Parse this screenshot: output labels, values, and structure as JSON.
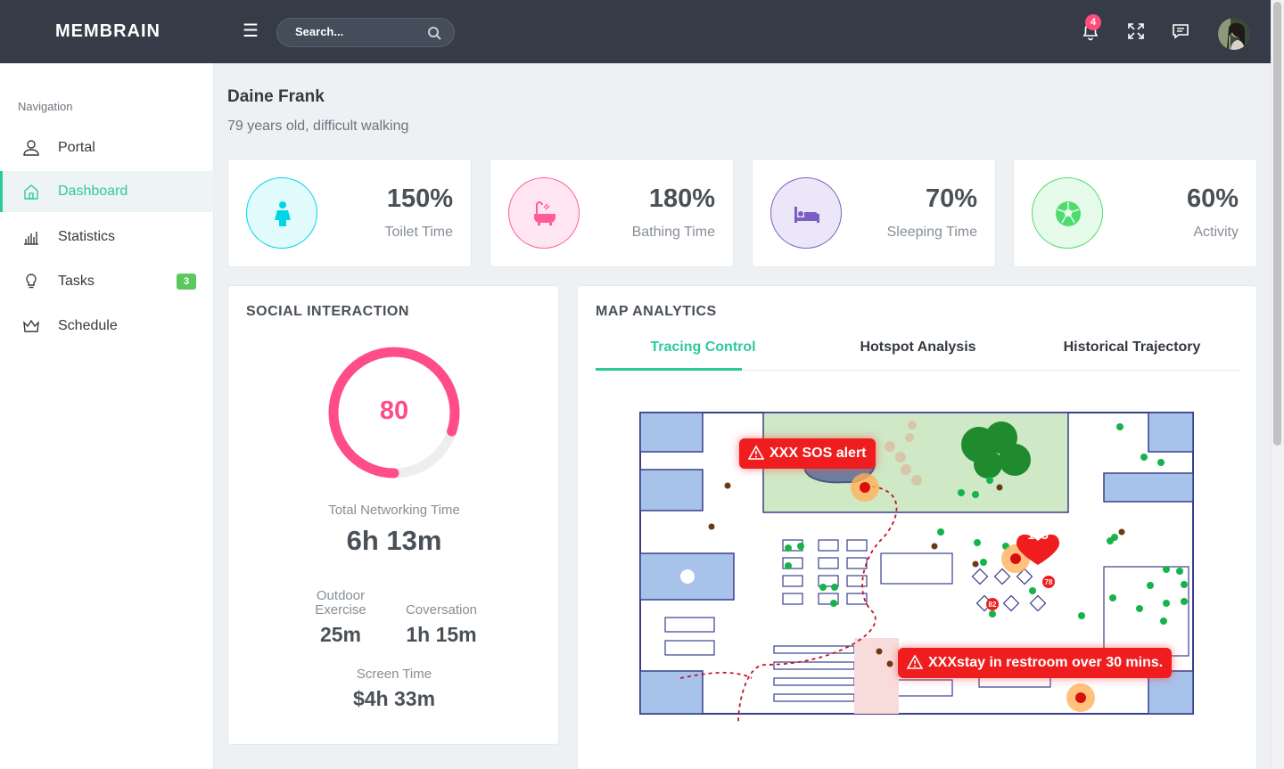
{
  "app": {
    "brand": "MEMBRAIN"
  },
  "search": {
    "placeholder": "Search..."
  },
  "topbar": {
    "notification_count": "4"
  },
  "sidebar": {
    "heading": "Navigation",
    "items": [
      {
        "label": "Portal",
        "icon": "user-icon",
        "active": false
      },
      {
        "label": "Dashboard",
        "icon": "home-icon",
        "active": true
      },
      {
        "label": "Statistics",
        "icon": "bar-chart-icon",
        "active": false
      },
      {
        "label": "Tasks",
        "icon": "lightbulb-icon",
        "active": false,
        "badge": "3"
      },
      {
        "label": "Schedule",
        "icon": "crown-icon",
        "active": false
      }
    ]
  },
  "patient": {
    "name": "Daine Frank",
    "description": "79 years old, difficult walking"
  },
  "stats": [
    {
      "value": "150%",
      "label": "Toilet Time",
      "icon": "person-icon",
      "color": "#00d4e8",
      "bg": "#e2fbfd"
    },
    {
      "value": "180%",
      "label": "Bathing Time",
      "icon": "bathtub-icon",
      "color": "#ff5c9a",
      "bg": "#ffe6f0"
    },
    {
      "value": "70%",
      "label": "Sleeping Time",
      "icon": "bed-icon",
      "color": "#7b5fc4",
      "bg": "#ece7f8"
    },
    {
      "value": "60%",
      "label": "Activity",
      "icon": "soccer-ball-icon",
      "color": "#4ddc70",
      "bg": "#e6fbea"
    }
  ],
  "social": {
    "title": "SOCIAL INTERACTION",
    "gauge_value": "80",
    "gauge_fraction": 0.8,
    "total_label": "Total Networking Time",
    "total_value": "6h 13m",
    "outdoor_label_1": "Outdoor",
    "outdoor_label_2": "Exercise",
    "outdoor_value": "25m",
    "conversation_label": "Coversation",
    "conversation_value": "1h 15m",
    "screen_label": "Screen Time",
    "screen_value": "$4h 33m"
  },
  "map": {
    "title": "MAP ANALYTICS",
    "tabs": [
      "Tracing Control",
      "Hotspot Analysis",
      "Historical Trajectory"
    ],
    "active_tab": 0,
    "alerts": {
      "sos": "XXX SOS alert",
      "restroom": "XXXstay in restroom over 30 mins."
    },
    "markers": {
      "heart_large": "135",
      "heart_small_1": "78",
      "heart_small_2": "82"
    }
  },
  "colors": {
    "accent": "#2dc99d",
    "topbar": "#353c48",
    "alert": "#ef1d1d",
    "gauge": "#ff4c8b"
  }
}
